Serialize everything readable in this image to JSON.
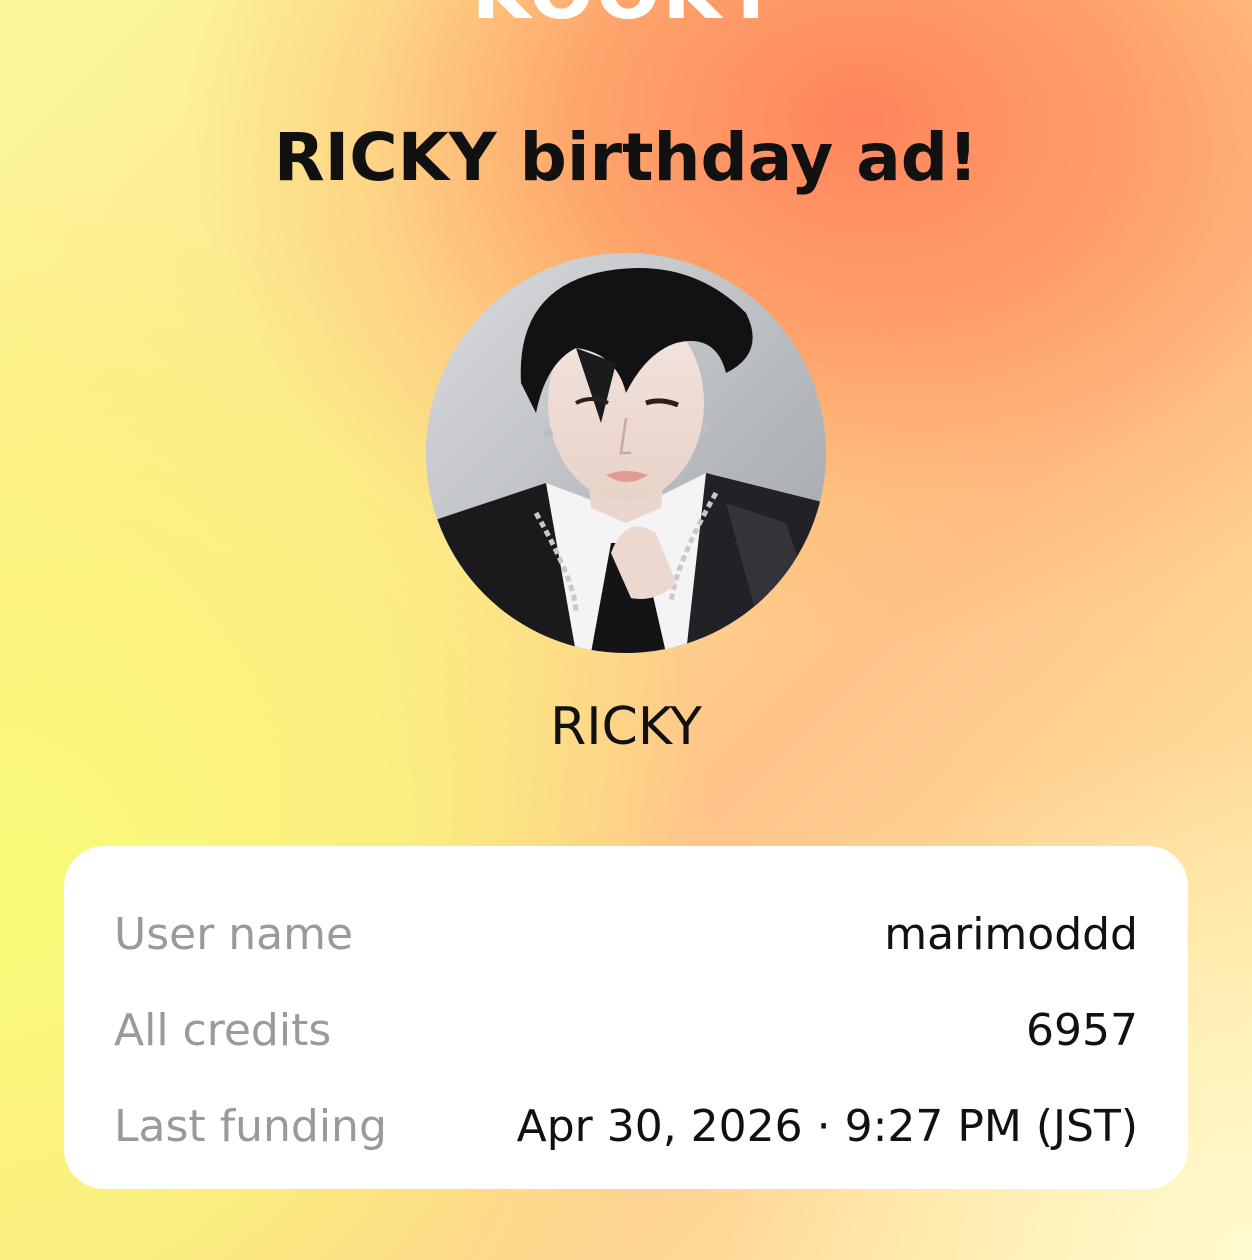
{
  "header": {
    "brand_logo_text": "KOOKY",
    "title": "RICKY birthday ad!"
  },
  "artist": {
    "name": "RICKY",
    "photo_icon": "artist-photo"
  },
  "info": {
    "rows": [
      {
        "label": "User name",
        "value": "marimoddd"
      },
      {
        "label": "All credits",
        "value": "6957"
      },
      {
        "label": "Last funding",
        "value": "Apr 30, 2026 · 9:27 PM (JST)"
      }
    ]
  },
  "colors": {
    "gradient_orange": "#ff8a5c",
    "gradient_yellow": "#fbf77e",
    "card_background": "#ffffff",
    "label_gray": "#9a9a9e",
    "text_dark": "#111111"
  }
}
